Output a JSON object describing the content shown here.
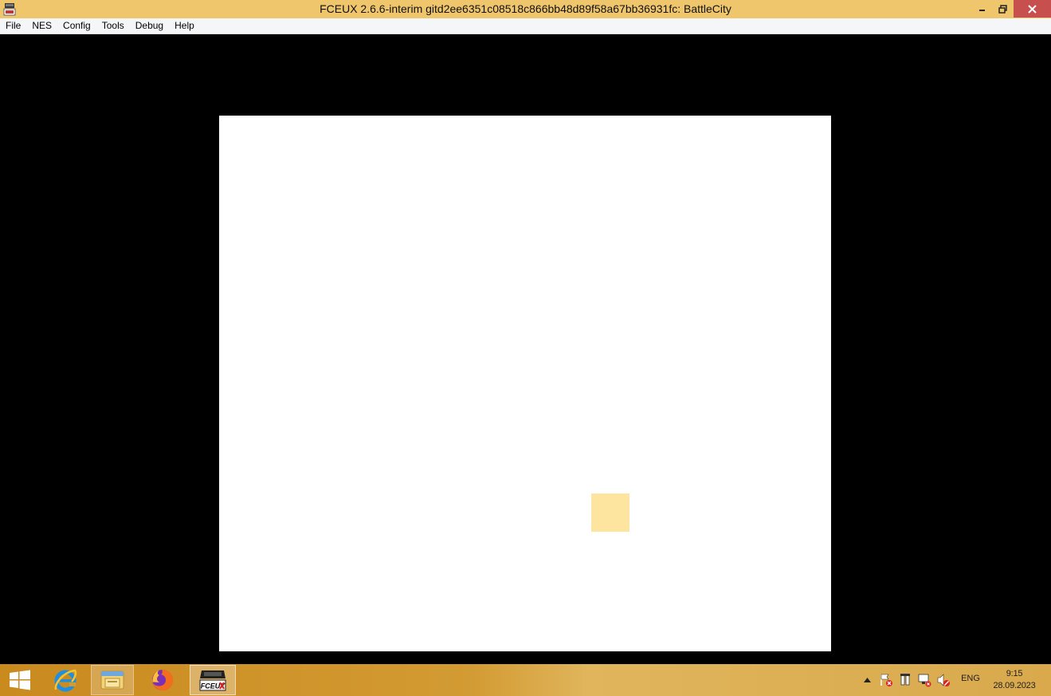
{
  "window": {
    "title": "FCEUX 2.6.6-interim gitd2ee6351c08518c866bb48d89f58a67bb36931fc: BattleCity"
  },
  "menu": {
    "items": [
      "File",
      "NES",
      "Config",
      "Tools",
      "Debug",
      "Help"
    ]
  },
  "emulator": {
    "screen_color": "#ffffff",
    "sprite_color": "#fde49f"
  },
  "taskbar": {
    "apps": [
      "start-icon",
      "internet-explorer-icon",
      "file-explorer-icon",
      "firefox-icon",
      "fceux-icon"
    ],
    "fceux_icon_label": "FCEUX",
    "language": "ENG",
    "time": "9:15",
    "date": "28.09.2023"
  },
  "colors": {
    "titlebar": "#f0c66d",
    "close_button": "#c7504f",
    "taskbar": "#d39b33"
  }
}
